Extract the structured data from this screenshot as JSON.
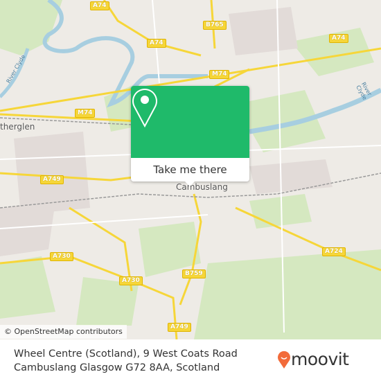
{
  "map": {
    "road_labels": [
      "A74",
      "A74",
      "B765",
      "A74",
      "M74",
      "M74",
      "A749",
      "A730",
      "A730",
      "B759",
      "A724",
      "A749"
    ],
    "places": [
      "therglen",
      "Cambuslang"
    ],
    "rivers": [
      "River Clyde",
      "River Clyde"
    ],
    "attribution": "© OpenStreetMap contributors"
  },
  "popup": {
    "icon": "map-pin-icon",
    "button_label": "Take me there",
    "color": "#1fba6a"
  },
  "footer": {
    "address_line1": "Wheel Centre (Scotland), 9 West Coats Road",
    "address_line2": "Cambuslang Glasgow G72 8AA, Scotland",
    "logo_text": "moovit",
    "logo_color": "#f26b3a"
  }
}
